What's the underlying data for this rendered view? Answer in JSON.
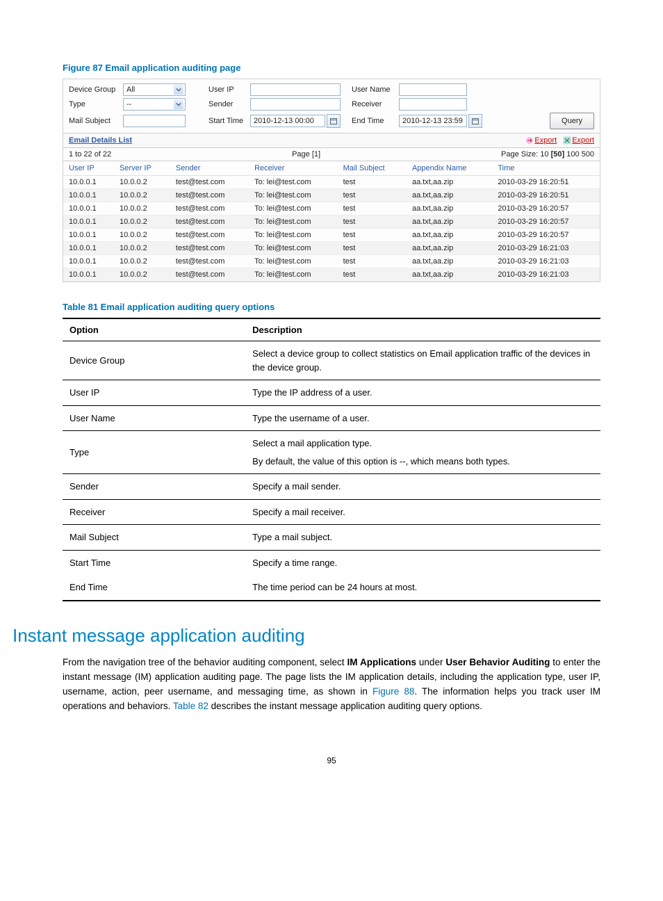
{
  "figureTitle": "Figure 87 Email application auditing page",
  "filters": {
    "deviceGroupLabel": "Device Group",
    "deviceGroupValue": "All",
    "userIpLabel": "User IP",
    "userNameLabel": "User Name",
    "typeLabel": "Type",
    "typeValue": "--",
    "senderLabel": "Sender",
    "receiverLabel": "Receiver",
    "mailSubjectLabel": "Mail Subject",
    "startTimeLabel": "Start Time",
    "startTimeValue": "2010-12-13 00:00",
    "endTimeLabel": "End Time",
    "endTimeValue": "2010-12-13 23:59",
    "queryLabel": "Query"
  },
  "details": {
    "listTitle": "Email Details List",
    "export1": "Export",
    "export2": "Export",
    "rangeText": "1 to 22 of 22",
    "pageLabel": "Page",
    "pageCurrent": "[1]",
    "pageSizeLabel": "Page Size:",
    "sizes": [
      "10",
      "[50]",
      "100",
      "500"
    ],
    "headers": {
      "userIp": "User IP",
      "serverIp": "Server IP",
      "sender": "Sender",
      "receiver": "Receiver",
      "mailSubject": "Mail Subject",
      "appendix": "Appendix Name",
      "time": "Time"
    },
    "rows": [
      {
        "userIp": "10.0.0.1",
        "serverIp": "10.0.0.2",
        "sender": "test@test.com",
        "receiver": "To: lei@test.com",
        "subject": "test",
        "appendix": "aa.txt,aa.zip",
        "time": "2010-03-29 16:20:51"
      },
      {
        "userIp": "10.0.0.1",
        "serverIp": "10.0.0.2",
        "sender": "test@test.com",
        "receiver": "To: lei@test.com",
        "subject": "test",
        "appendix": "aa.txt,aa.zip",
        "time": "2010-03-29 16:20:51"
      },
      {
        "userIp": "10.0.0.1",
        "serverIp": "10.0.0.2",
        "sender": "test@test.com",
        "receiver": "To: lei@test.com",
        "subject": "test",
        "appendix": "aa.txt,aa.zip",
        "time": "2010-03-29 16:20:57"
      },
      {
        "userIp": "10.0.0.1",
        "serverIp": "10.0.0.2",
        "sender": "test@test.com",
        "receiver": "To: lei@test.com",
        "subject": "test",
        "appendix": "aa.txt,aa.zip",
        "time": "2010-03-29 16:20:57"
      },
      {
        "userIp": "10.0.0.1",
        "serverIp": "10.0.0.2",
        "sender": "test@test.com",
        "receiver": "To: lei@test.com",
        "subject": "test",
        "appendix": "aa.txt,aa.zip",
        "time": "2010-03-29 16:20:57"
      },
      {
        "userIp": "10.0.0.1",
        "serverIp": "10.0.0.2",
        "sender": "test@test.com",
        "receiver": "To: lei@test.com",
        "subject": "test",
        "appendix": "aa.txt,aa.zip",
        "time": "2010-03-29 16:21:03"
      },
      {
        "userIp": "10.0.0.1",
        "serverIp": "10.0.0.2",
        "sender": "test@test.com",
        "receiver": "To: lei@test.com",
        "subject": "test",
        "appendix": "aa.txt,aa.zip",
        "time": "2010-03-29 16:21:03"
      },
      {
        "userIp": "10.0.0.1",
        "serverIp": "10.0.0.2",
        "sender": "test@test.com",
        "receiver": "To: lei@test.com",
        "subject": "test",
        "appendix": "aa.txt,aa.zip",
        "time": "2010-03-29 16:21:03"
      }
    ]
  },
  "tableTitle": "Table 81 Email application auditing query options",
  "optsHeader": {
    "option": "Option",
    "description": "Description"
  },
  "opts": [
    {
      "option": "Device Group",
      "desc": "Select a device group to collect statistics on Email application traffic of the devices in the device group."
    },
    {
      "option": "User IP",
      "desc": "Type the IP address of a user."
    },
    {
      "option": "User Name",
      "desc": "Type the username of a user."
    },
    {
      "option": "Type",
      "desc": "Select a mail application type.",
      "desc2": "By default, the value of this option is --, which means both types."
    },
    {
      "option": "Sender",
      "desc": "Specify a mail sender."
    },
    {
      "option": "Receiver",
      "desc": "Specify a mail receiver."
    },
    {
      "option": "Mail Subject",
      "desc": "Type a mail subject."
    },
    {
      "option": "Start Time",
      "desc": "Specify a time range.",
      "noborder": true
    },
    {
      "option": "End Time",
      "desc": "The time period can be 24 hours at most."
    }
  ],
  "sectionTitle": "Instant message application auditing",
  "body": {
    "p1a": "From the navigation tree of the behavior auditing component, select ",
    "p1b": "IM Applications",
    "p1c": " under ",
    "p1d": "User Behavior Auditing",
    "p1e": " to enter the instant message (IM) application auditing page. The page lists the IM application details, including the application type, user IP, username, action, peer username, and messaging time, as shown in ",
    "p1f": "Figure 88",
    "p1g": ". The information helps you track user IM operations and behaviors. ",
    "p1h": "Table 82",
    "p1i": " describes the instant message application auditing query options."
  },
  "pageNumber": "95"
}
